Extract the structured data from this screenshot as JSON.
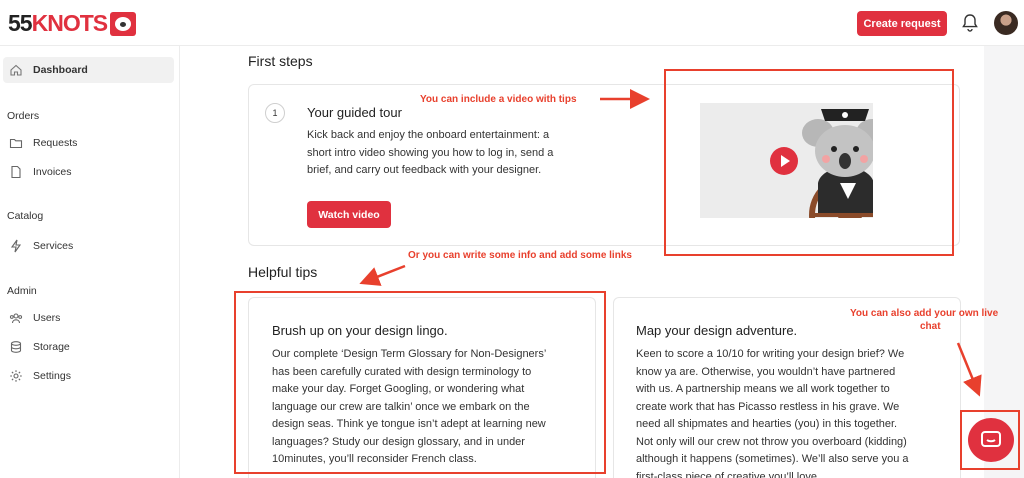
{
  "header": {
    "logo_number": "55",
    "logo_word": "KNOTS",
    "create_request_label": "Create request"
  },
  "sidebar": {
    "dashboard_label": "Dashboard",
    "sections": [
      {
        "title": "Orders",
        "items": [
          {
            "label": "Requests",
            "icon": "folder-icon"
          },
          {
            "label": "Invoices",
            "icon": "document-icon"
          }
        ]
      },
      {
        "title": "Catalog",
        "items": [
          {
            "label": "Services",
            "icon": "bolt-icon"
          }
        ]
      },
      {
        "title": "Admin",
        "items": [
          {
            "label": "Users",
            "icon": "users-icon"
          },
          {
            "label": "Storage",
            "icon": "database-icon"
          },
          {
            "label": "Settings",
            "icon": "gear-icon"
          }
        ]
      }
    ]
  },
  "main": {
    "first_steps_title": "First steps",
    "step": {
      "number": "1",
      "title": "Your guided tour",
      "text_lines": [
        "Kick back and enjoy the onboard entertainment: a",
        "short intro video showing you how to log in, send a",
        "brief, and carry out feedback with your designer."
      ],
      "button_label": "Watch video"
    },
    "helpful_tips_title": "Helpful tips",
    "tips": [
      {
        "title": "Brush up on your design lingo.",
        "text_lines": [
          "Our complete ‘Design Term Glossary for Non-Designers’",
          "has been carefully curated with design terminology to",
          "make your day. Forget Googling, or wondering what",
          "language our crew are talkin’ once we embark on the",
          "design seas. Think ye tongue isn’t adept at learning new",
          "languages? Study our design glossary, and in under",
          "10minutes, you’ll reconsider French class."
        ]
      },
      {
        "title": "Map your design adventure.",
        "text_lines": [
          "Keen to score a 10/10 for writing your design brief? We",
          "know ya are. Otherwise, you wouldn’t have partnered",
          "with us. A partnership means we all work together to",
          "create work that has Picasso restless in his grave. We",
          "need all shipmates and hearties (you) in this together.",
          "Not only will our crew not throw you overboard (kidding)",
          "although it happens (sometimes). We’ll also serve you a",
          "first-class piece of creative you’ll love."
        ]
      }
    ]
  },
  "annotations": {
    "video_tip": "You can include a video with tips",
    "links_tip": "Or you can write some info and add some links",
    "chat_tip_line1": "You can also add your own live",
    "chat_tip_line2": "chat"
  },
  "colors": {
    "brand_red": "#e0313f",
    "annotation_red": "#e8402d"
  }
}
